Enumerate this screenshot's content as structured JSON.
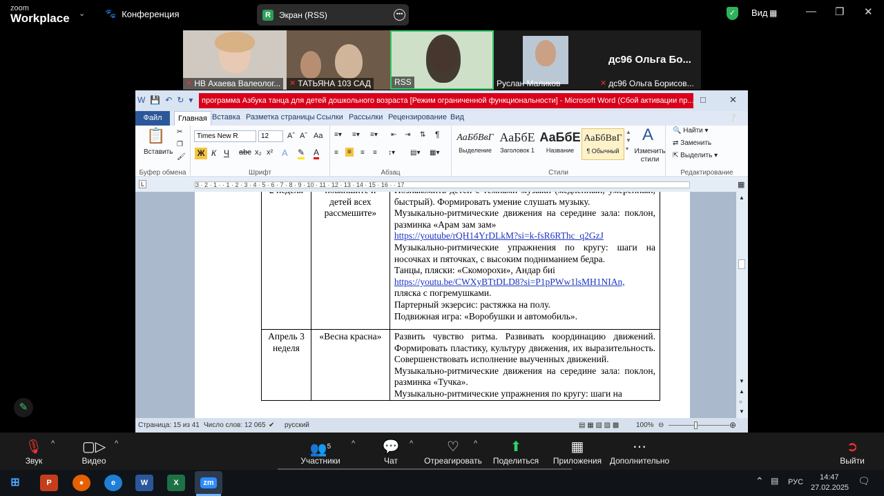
{
  "zoom": {
    "logo_top": "zoom",
    "logo_bottom": "Workplace",
    "conference_label": "Конференция",
    "share_badge": "R",
    "share_label": "Экран (RSS)",
    "view_label": "Вид",
    "participants_count": "5",
    "participants": [
      {
        "name": "НВ Ахаева Валеолог..."
      },
      {
        "name": "ТАТЬЯНА 103 САД"
      },
      {
        "name": "RSS"
      },
      {
        "name": "Руслан Маликов"
      },
      {
        "name": "дс96 Ольга Борисов..."
      }
    ],
    "tile_big_name": "дс96  Ольга  Бо...",
    "toolbar": {
      "audio": "Звук",
      "video": "Видео",
      "participants": "Участники",
      "chat": "Чат",
      "react": "Отреагировать",
      "share": "Поделиться",
      "apps": "Приложения",
      "more": "Дополнительно",
      "leave": "Выйти"
    }
  },
  "word": {
    "title": "программа Азбука танца для детей дошкольного возраста [Режим ограниченной функциональности] - Microsoft Word (Сбой активации пр...",
    "tabs": [
      "Файл",
      "Главная",
      "Вставка",
      "Разметка страницы",
      "Ссылки",
      "Рассылки",
      "Рецензирование",
      "Вид"
    ],
    "ribbon": {
      "paste": "Вставить",
      "clipboard_group": "Буфер обмена",
      "font_name": "Times New R",
      "font_size": "12",
      "font_group": "Шрифт",
      "paragraph_group": "Абзац",
      "styles_group": "Стили",
      "styles": [
        {
          "sample": "АаБбВвГ",
          "label": "Выделение"
        },
        {
          "sample": "АаБбЕ",
          "label": "Заголовок 1"
        },
        {
          "sample": "АаБбЕ",
          "label": "Название"
        },
        {
          "sample": "АаБбВвГ",
          "label": "¶ Обычный"
        }
      ],
      "change_styles": "Изменить стили",
      "find": "Найти",
      "replace": "Заменить",
      "select": "Выделить",
      "editing_group": "Редактирование"
    },
    "ruler_text": "3 · 2 · 1 ·   · 1 · 2 · 3 · 4 · 5 · 6 · 7 · 8 · 9 · 10 · 11 · 12 · 13 · 14 · 15 · 16 ·   · 17",
    "table": {
      "row1": {
        "week": "2 неделя",
        "theme": "повяпшите и детей всех рассмешите»",
        "lines": [
          "Познакомить детей с темпами музыки (медленный, умеренный, быстрый). Формировать умение слушать музыку.",
          "Музыкально-ритмические движения на середине зала: поклон, разминка «Арам зам зам»",
          "https://youtube/rQH14YrDLkM?si=k-fsR6RThc_q2GzJ",
          "Музыкально-ритмические упражнения по кругу: шаги на носочках и пяточках, с высоким подниманием бедра.",
          "Танцы, пляски: «Скоморохи», Андар биі",
          "https://youtu.be/CWXyBTtDLD8?si=P1pPWw1lsMH1NIAn,",
          "пляска с погремушками.",
          "Партерный экзерсис: растяжка на полу.",
          "Подвижная игра: «Воробушки и автомобиль»."
        ]
      },
      "row2": {
        "week": "Апрель 3 неделя",
        "theme": "«Весна красна»",
        "lines": [
          "Развить чувство ритма. Развивать координацию движений. Формировать пластику, культуру движения, их выразительность. Совершенствовать исполнение выученных движений.",
          "Музыкально-ритмические движения на середине зала: поклон, разминка «Тучка».",
          "Музыкально-ритмические упражнения по кругу: шаги на"
        ]
      }
    },
    "status": {
      "page": "Страница: 15 из 41",
      "words": "Число слов: 12 065",
      "lang": "русский",
      "zoom": "100%"
    }
  },
  "taskbar": {
    "lang": "РУС",
    "time": "14:47",
    "date": "27.02.2025"
  }
}
